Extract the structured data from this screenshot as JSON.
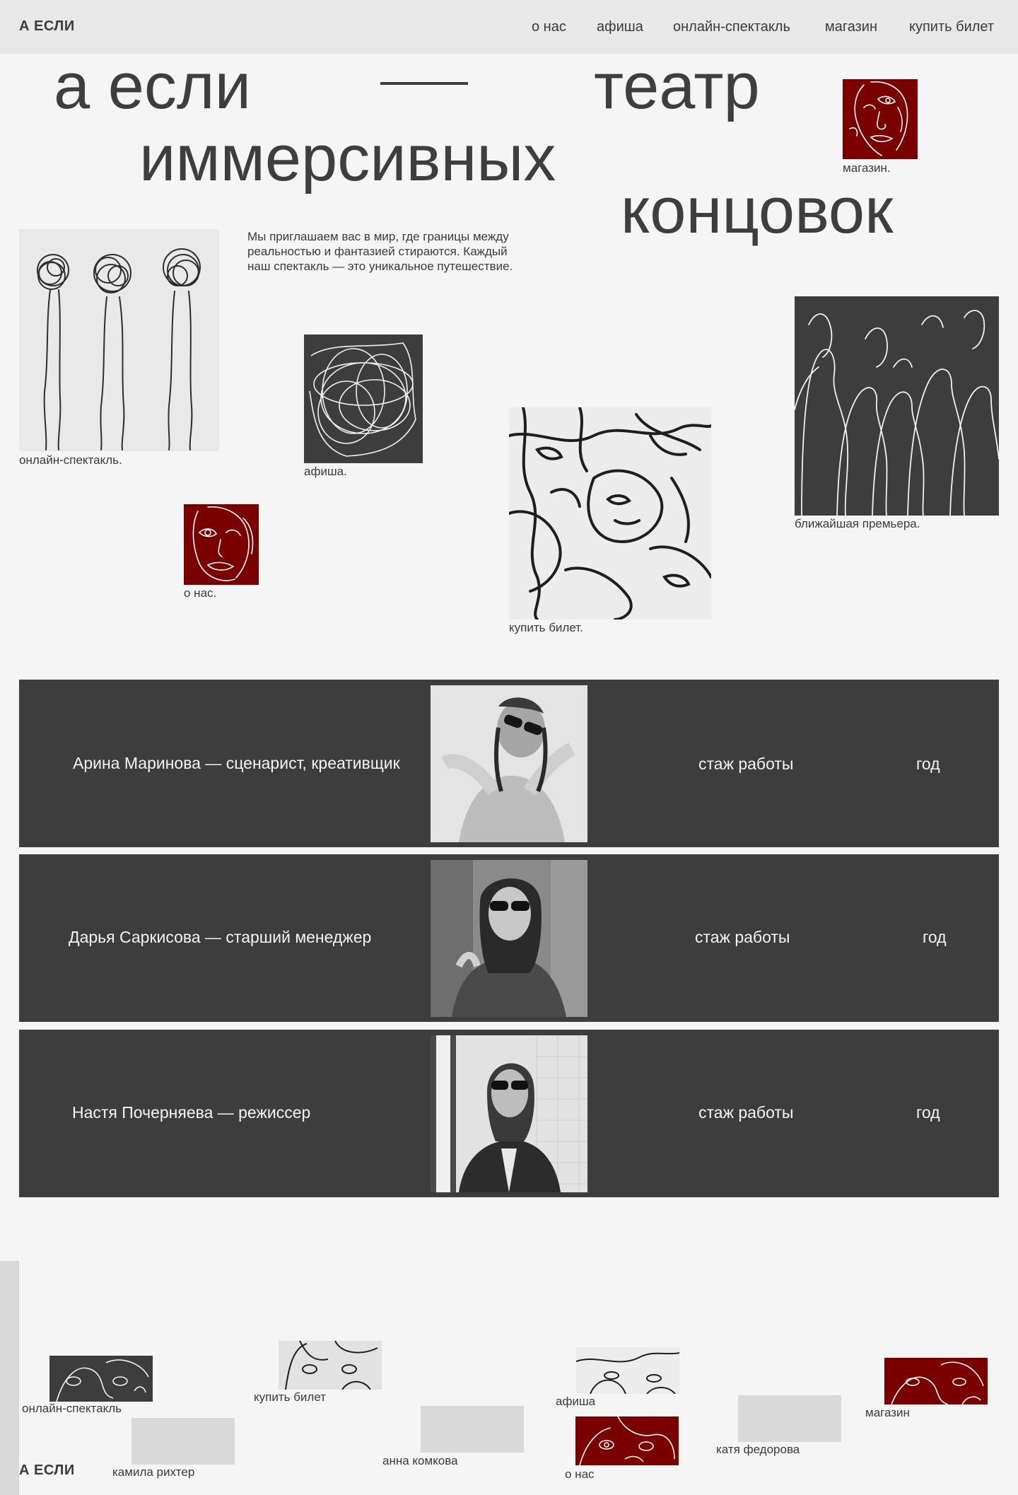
{
  "header": {
    "logo": "А ЕСЛИ",
    "nav": [
      "о нас",
      "афиша",
      "онлайн-спектакль",
      "магазин",
      "купить билет"
    ]
  },
  "hero": {
    "line1a": "а если",
    "line1b": "театр",
    "line2": "иммерсивных",
    "line3": "концовок"
  },
  "intro_text": "Мы приглашаем вас в мир, где границы между реальностью и фантазией стираются. Каждый наш спектакль — это уникальное путешествие.",
  "tiles": {
    "shop": "магазин.",
    "online": "онлайн-спектакль.",
    "afisha": "афиша.",
    "about": "о нас.",
    "ticket": "купить билет.",
    "premiere": "ближайшая премьера."
  },
  "team": [
    {
      "name": "Арина Маринова — сценарист, креативщик",
      "experience": "стаж работы",
      "year": "год"
    },
    {
      "name": "Дарья Саркисова — старший менеджер",
      "experience": "стаж работы",
      "year": "год"
    },
    {
      "name": "Настя Почерняева — режиссер",
      "experience": "стаж работы",
      "year": "год"
    }
  ],
  "footer": {
    "logo": "А ЕСЛИ",
    "links": {
      "online": "онлайн-спектакль",
      "ticket": "купить билет",
      "afisha": "афиша",
      "shop": "магазин",
      "about": "о нас"
    },
    "credits": [
      "камила рихтер",
      "анна комкова",
      "катя федорова"
    ]
  },
  "colors": {
    "background": "#f5f5f5",
    "header": "#e8e8e8",
    "dark": "#3d3d3d",
    "accent_red": "#7a0000",
    "placeholder": "#d9d9d9"
  }
}
